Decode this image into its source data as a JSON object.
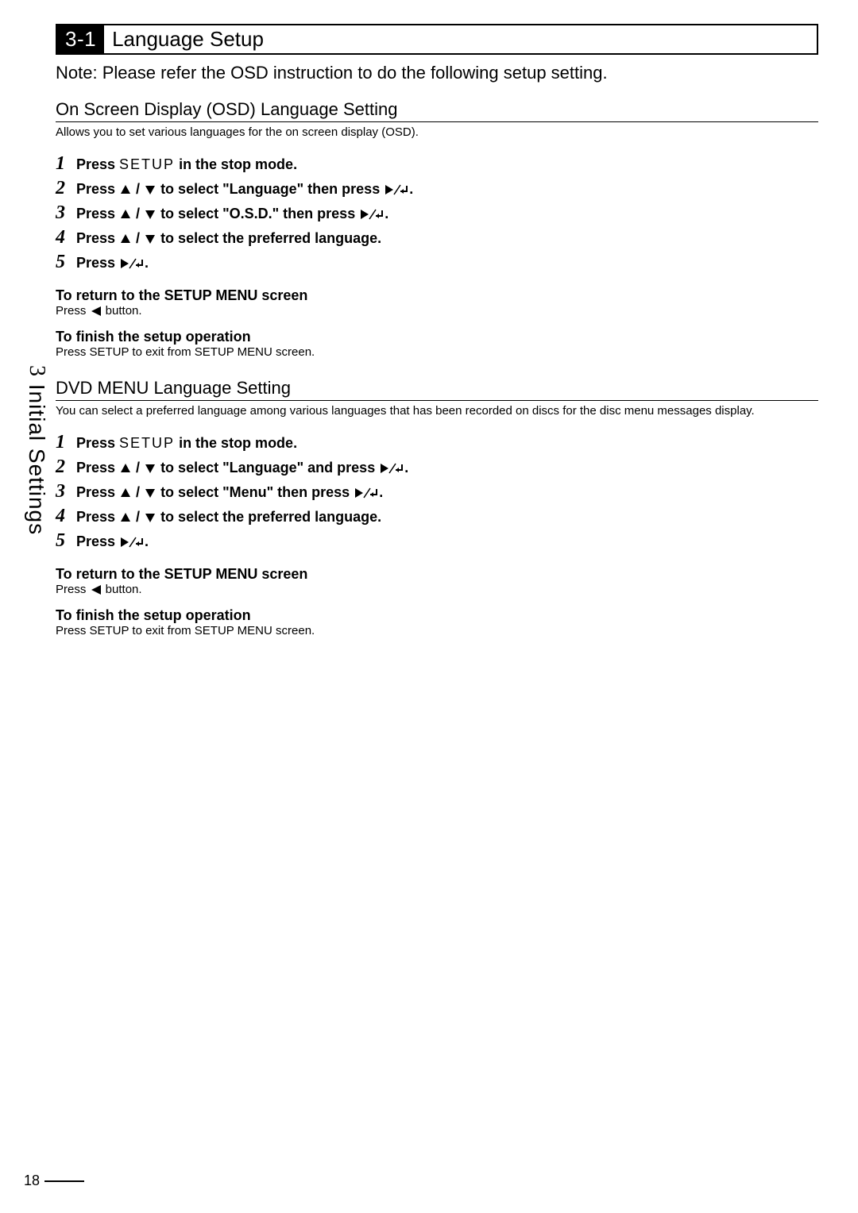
{
  "header": {
    "num": "3-1",
    "title": "Language Setup"
  },
  "note": "Note: Please refer the OSD instruction to do the following setup setting.",
  "osd": {
    "heading": "On Screen Display (OSD) Language Setting",
    "desc": "Allows you to set various languages for the on screen display (OSD).",
    "steps": {
      "s1_pre": "Press ",
      "s1_setup": "SETUP",
      "s1_post": " in the stop mode.",
      "s2_pre": "Press ",
      "s2_mid": " to select \"Language\" then press ",
      "s2_post": ".",
      "s3_pre": "Press ",
      "s3_mid": " to select \"O.S.D.\" then press ",
      "s3_post": ".",
      "s4_pre": "Press ",
      "s4_post": " to select the preferred language.",
      "s5_pre": "Press ",
      "s5_post": "."
    },
    "return_title": "To return to the SETUP MENU screen",
    "return_text_pre": "Press ",
    "return_text_post": " button.",
    "finish_title": "To finish the setup operation",
    "finish_text": "Press SETUP to exit from SETUP MENU screen."
  },
  "dvd": {
    "heading": "DVD MENU Language Setting",
    "desc": "You can select a preferred language among various languages that has been recorded on discs for the disc menu messages display.",
    "steps": {
      "s1_pre": "Press ",
      "s1_setup": "SETUP",
      "s1_post": " in the stop mode.",
      "s2_pre": "Press ",
      "s2_mid": " to select \"Language\" and press ",
      "s2_post": ".",
      "s3_pre": "Press ",
      "s3_mid": " to select \"Menu\" then press ",
      "s3_post": ".",
      "s4_pre": "Press ",
      "s4_post": " to select the preferred language.",
      "s5_pre": "Press ",
      "s5_post": "."
    },
    "return_title": "To return to the SETUP MENU screen",
    "return_text_pre": "Press ",
    "return_text_post": " button.",
    "finish_title": "To finish the setup operation",
    "finish_text": "Press SETUP to exit from SETUP MENU screen."
  },
  "sidebar": {
    "num": "3",
    "text": " Initial Settings"
  },
  "page_number": "18",
  "step_numbers": {
    "n1": "1",
    "n2": "2",
    "n3": "3",
    "n4": "4",
    "n5": "5"
  }
}
